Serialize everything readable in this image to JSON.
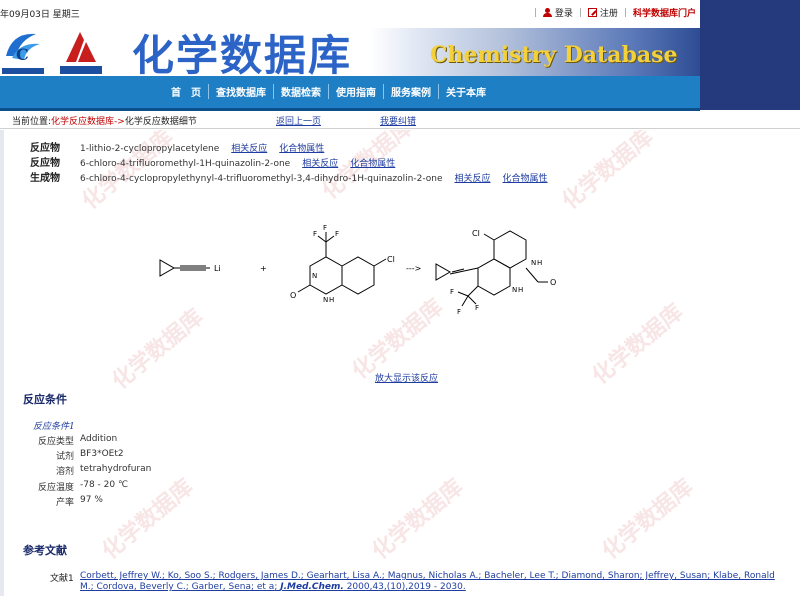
{
  "topbar": {
    "date": "年09月03日 星期三",
    "login": "登录",
    "register": "注册",
    "portal": "科学数据库门户",
    "separator": "|"
  },
  "banner": {
    "title": "化学数据库",
    "title_en": "Chemistry Database"
  },
  "nav": {
    "items": [
      "首　页",
      "查找数据库",
      "数据检索",
      "使用指南",
      "服务案例",
      "关于本库"
    ]
  },
  "breadcrumb": {
    "prefix": "当前位置:",
    "link": "化学反应数据库->",
    "current": "化学反应数据细节",
    "back": "返回上一页",
    "report": "我要纠错"
  },
  "compounds": [
    {
      "role": "反应物",
      "name": "1-lithio-2-cyclopropylacetylene",
      "link1": "相关反应",
      "link2": "化合物属性"
    },
    {
      "role": "反应物",
      "name": "6-chloro-4-trifluoromethyl-1H-quinazolin-2-one",
      "link1": "相关反应",
      "link2": "化合物属性"
    },
    {
      "role": "生成物",
      "name": "6-chloro-4-cyclopropylethynyl-4-trifluoromethyl-3,4-dihydro-1H-quinazolin-2-one",
      "link1": "相关反应",
      "link2": "化合物属性"
    }
  ],
  "scheme": {
    "plus": "+",
    "arrow": "--->",
    "atoms": {
      "li": "Li",
      "cl": "Cl",
      "f": "F",
      "n": "N",
      "h": "H",
      "o": "O"
    }
  },
  "enlarge": "放大显示该反应",
  "conditions": {
    "title": "反应条件",
    "subtitle": "反应条件1",
    "rows": [
      {
        "k": "反应类型",
        "v": "Addition"
      },
      {
        "k": "试剂",
        "v": "BF3*OEt2"
      },
      {
        "k": "溶剂",
        "v": "tetrahydrofuran"
      },
      {
        "k": "反应温度",
        "v": "-78 - 20 ℃"
      },
      {
        "k": "产率",
        "v": "97 %"
      }
    ]
  },
  "references": {
    "title": "参考文献",
    "label": "文献1",
    "authors": "Corbett, Jeffrey W.; Ko, Soo S.; Rodgers, James D.; Gearhart, Lisa A.; Magnus, Nicholas A.; Bacheler, Lee T.; Diamond, Sharon; Jeffrey, Susan; Klabe, Ronald M.; Cordova, Beverly C.; Garber, Sena; et a",
    "sep": "; ",
    "journal": "J.Med.Chem.",
    "citation": " 2000,43,(10),2019 - 2030."
  },
  "watermark_text": "化学数据库"
}
